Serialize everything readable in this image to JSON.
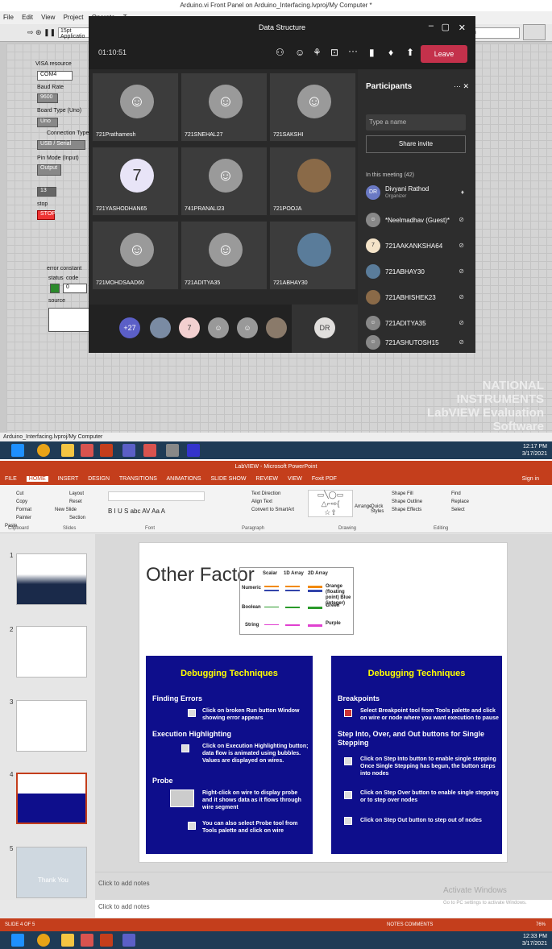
{
  "labview": {
    "title": "Arduino.vi Front Panel on Arduino_Interfacing.lvproj/My Computer *",
    "menu": [
      "File",
      "Edit",
      "View",
      "Project",
      "Operate",
      "T"
    ],
    "toolbar_font": "15pt Applicatio",
    "search_placeholder": "Search",
    "controls": {
      "visa_resource": "VISA resource",
      "visa_value": "COM4",
      "baud_rate": "Baud Rate",
      "baud_value": "9600",
      "board_type": "Board Type (Uno)",
      "board_value": "Uno",
      "conn_type": "Connection Type (USB/Seri",
      "conn_value": "USB / Serial",
      "pin_mode": "Pin Mode (Input)",
      "pin_value": "Output",
      "num_value": "13",
      "stop_label": "stop",
      "stop_btn": "STOP",
      "error_constant": "error constant",
      "status": "status",
      "code": "code",
      "code_value": "0",
      "source": "source"
    },
    "status_bar": "Arduino_Interfacing.lvproj/My Computer",
    "ni_watermark": "NATIONAL INSTRUMENTS LabVIEW Evaluation Software"
  },
  "taskbar_top": {
    "time": "12:17 PM",
    "date": "3/17/2021"
  },
  "teams": {
    "title": "Data Structure",
    "elapsed": "01:10:51",
    "leave": "Leave",
    "tiles": [
      {
        "name": "721Prathamesh",
        "initial": ""
      },
      {
        "name": "721SNEHAL27",
        "initial": ""
      },
      {
        "name": "721SAKSHI",
        "initial": ""
      },
      {
        "name": "721YASHODHAN65",
        "initial": "7"
      },
      {
        "name": "741PRANALI23",
        "initial": ""
      },
      {
        "name": "721POOJA",
        "initial": ""
      },
      {
        "name": "721MOHDSAAD60",
        "initial": ""
      },
      {
        "name": "721ADITYA35",
        "initial": ""
      },
      {
        "name": "721ABHAY30",
        "initial": ""
      }
    ],
    "strip": [
      "+27",
      "",
      "7",
      "",
      "",
      "",
      "DR"
    ],
    "participants": {
      "title": "Participants",
      "search": "Type a name",
      "share": "Share invite",
      "in_meeting": "In this meeting (42)",
      "items": [
        {
          "initials": "DR",
          "name": "Divyani Rathod",
          "sub": "Organizer"
        },
        {
          "initials": "",
          "name": "*Neelmadhav (Guest)*",
          "sub": ""
        },
        {
          "initials": "7",
          "name": "721AAKANKSHA64",
          "sub": ""
        },
        {
          "initials": "",
          "name": "721ABHAY30",
          "sub": ""
        },
        {
          "initials": "",
          "name": "721ABHISHEK23",
          "sub": ""
        },
        {
          "initials": "",
          "name": "721ADITYA35",
          "sub": ""
        },
        {
          "initials": "",
          "name": "721ASHUTOSH15",
          "sub": ""
        }
      ]
    }
  },
  "powerpoint": {
    "title": "LabVIEW - Microsoft PowerPoint",
    "tabs": [
      "FILE",
      "HOME",
      "INSERT",
      "DESIGN",
      "TRANSITIONS",
      "ANIMATIONS",
      "SLIDE SHOW",
      "REVIEW",
      "VIEW",
      "Foxit PDF"
    ],
    "signin": "Sign in",
    "groups": [
      "Clipboard",
      "Slides",
      "Font",
      "Paragraph",
      "Drawing",
      "Editing"
    ],
    "clipboard": [
      "Cut",
      "Copy",
      "Format Painter",
      "Paste"
    ],
    "slides_grp": [
      "Layout",
      "Reset",
      "New Slide",
      "Section"
    ],
    "paragraph": [
      "Text Direction",
      "Align Text",
      "Convert to SmartArt"
    ],
    "drawing": [
      "Shape Fill",
      "Shape Outline",
      "Shape Effects",
      "Arrange",
      "Quick Styles"
    ],
    "editing": [
      "Find",
      "Replace",
      "Select"
    ],
    "thumb_numbers": [
      "1",
      "2",
      "3",
      "4",
      "5"
    ],
    "thumb5_text": "Thank You",
    "slide": {
      "title": "Other Factor",
      "legend": {
        "headers": [
          "Scalar",
          "1D Array",
          "2D Array"
        ],
        "rows": [
          {
            "label": "Numeric",
            "desc": "Orange (floating point) Blue (integer)"
          },
          {
            "label": "Boolean",
            "desc": "Green"
          },
          {
            "label": "String",
            "desc": "Purple"
          }
        ]
      },
      "left_box": {
        "title": "Debugging Techniques",
        "b1": "Finding Errors",
        "t1": "Click on broken Run button Window showing error appears",
        "b2": "Execution Highlighting",
        "t2": "Click on Execution Highlighting button; data flow is animated using bubbles. Values are displayed on wires.",
        "b3": "Probe",
        "t3": "Right-click on wire to display probe and it shows data as it flows through wire segment",
        "t4": "You can also select Probe tool from Tools palette and click on wire"
      },
      "right_box": {
        "title": "Debugging Techniques",
        "b1": "Breakpoints",
        "t1": "Select Breakpoint tool from Tools palette and click on wire or node where you want execution to pause",
        "b2": "Step Into, Over, and Out buttons for Single Stepping",
        "t2": "Click on Step Into button to enable single stepping Once Single Stepping has begun, the button steps into nodes",
        "t3": "Click on Step Over button to enable single stepping or to step over nodes",
        "t4": "Click on Step Out button to step out of nodes"
      }
    },
    "notes": "Click to add notes",
    "activate": "Activate Windows",
    "activate_sub": "Go to PC settings to activate Windows.",
    "status_left": "SLIDE 4 OF 5",
    "status_right": "NOTES   COMMENTS",
    "zoom": "76%"
  },
  "taskbar_bottom": {
    "time": "12:33 PM",
    "date": "3/17/2021"
  }
}
